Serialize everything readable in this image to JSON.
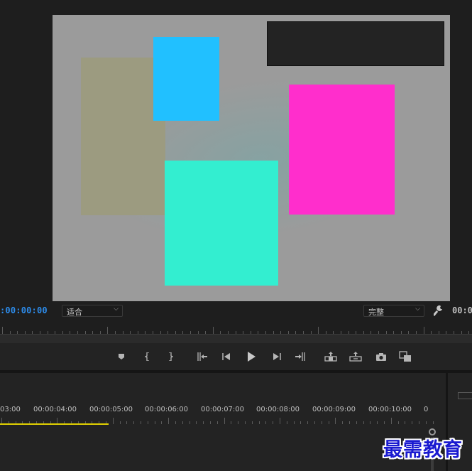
{
  "monitor": {
    "timecode_left": ":00:00:00",
    "timecode_right": "00:0",
    "zoom_dropdown": "适合",
    "quality_dropdown": "完整"
  },
  "canvas": {
    "background": "#9b9b9b",
    "shapes": [
      {
        "name": "olive-rectangle",
        "color": "#9c9b80"
      },
      {
        "name": "blue-rectangle",
        "color": "#21c0ff"
      },
      {
        "name": "magenta-rectangle",
        "color": "#ff2ecc"
      },
      {
        "name": "cyan-rectangle",
        "color": "#33eed0"
      }
    ],
    "title_box_color": "#232323"
  },
  "transport": {
    "buttons": [
      {
        "name": "add-marker-button",
        "icon": "marker-icon"
      },
      {
        "name": "mark-in-button",
        "icon": "mark-in-icon"
      },
      {
        "name": "mark-out-button",
        "icon": "mark-out-icon"
      },
      {
        "name": "go-to-in-button",
        "icon": "go-to-in-icon"
      },
      {
        "name": "step-back-button",
        "icon": "step-back-icon"
      },
      {
        "name": "play-button",
        "icon": "play-icon"
      },
      {
        "name": "step-forward-button",
        "icon": "step-forward-icon"
      },
      {
        "name": "go-to-out-button",
        "icon": "go-to-out-icon"
      },
      {
        "name": "lift-button",
        "icon": "lift-icon"
      },
      {
        "name": "extract-button",
        "icon": "extract-icon"
      },
      {
        "name": "export-frame-button",
        "icon": "camera-icon"
      },
      {
        "name": "comparison-view-button",
        "icon": "comparison-icon"
      }
    ]
  },
  "timeline": {
    "labels": [
      "03:00",
      "00:00:04:00",
      "00:00:05:00",
      "00:00:06:00",
      "00:00:07:00",
      "00:00:08:00",
      "00:00:09:00",
      "00:00:10:00",
      "0"
    ],
    "work_area_color": "#e0d000"
  },
  "watermark": {
    "text": "最需教育",
    "color": "#1a1ad0"
  }
}
